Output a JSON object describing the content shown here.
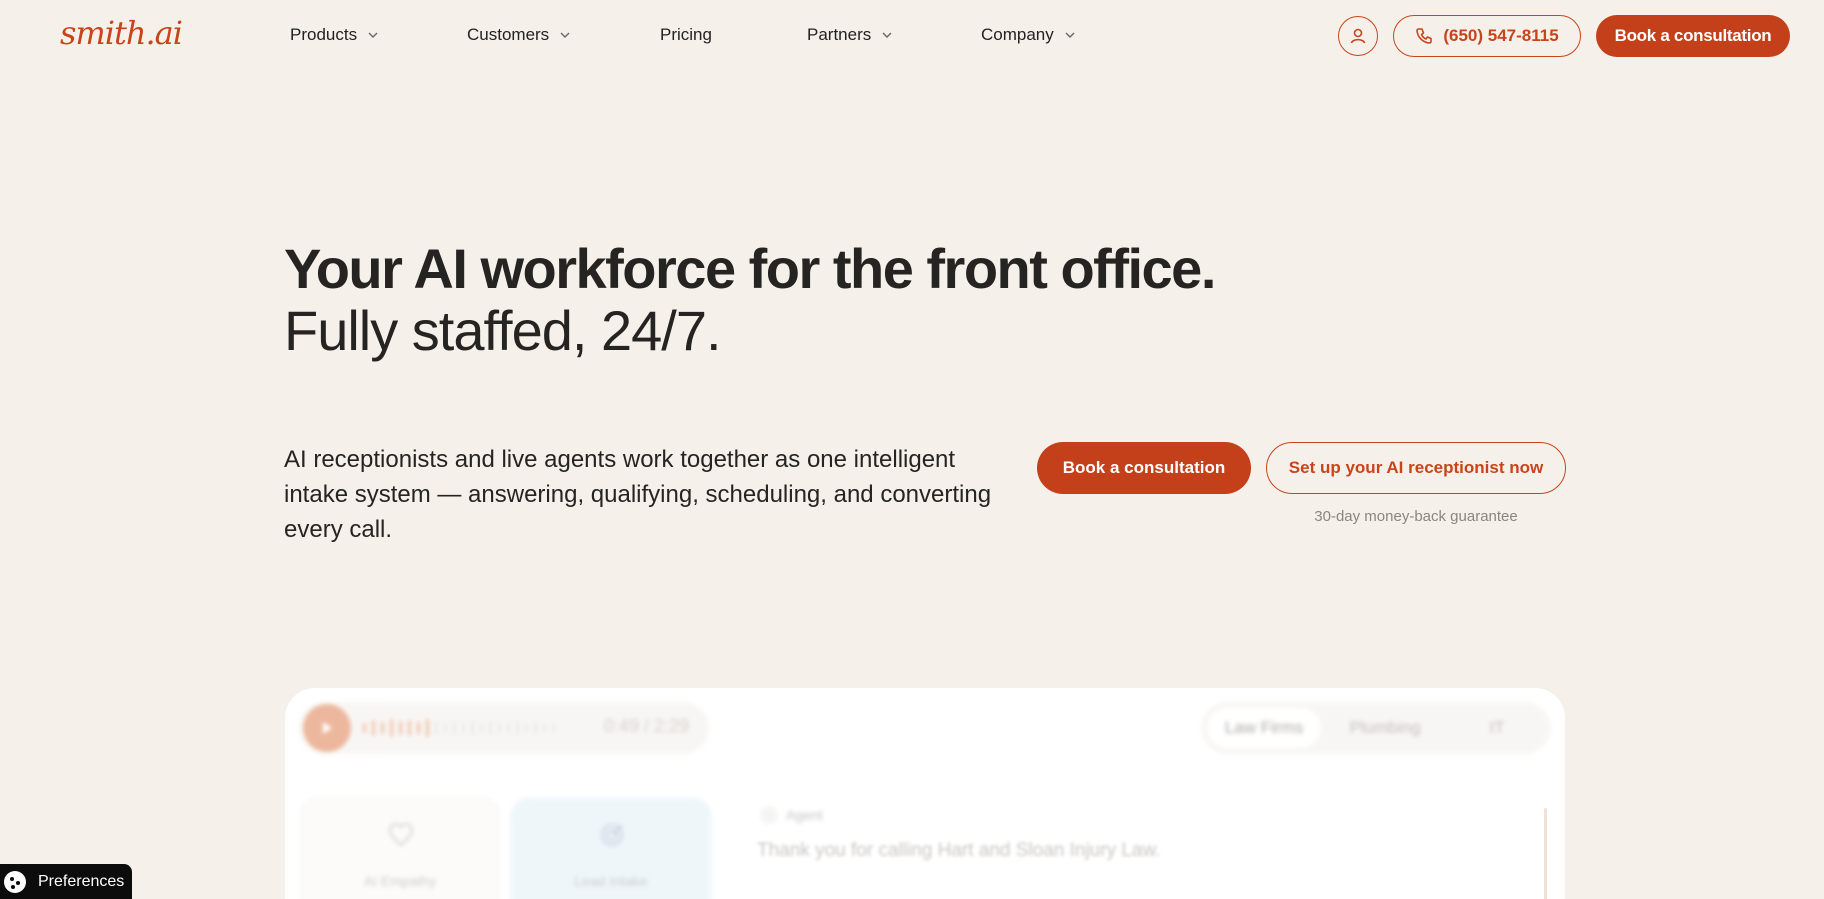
{
  "brand": {
    "logo": "smith.ai",
    "accent": "#c4401a",
    "background": "#f5f1ea"
  },
  "nav": {
    "items": [
      {
        "label": "Products",
        "has_dropdown": true
      },
      {
        "label": "Customers",
        "has_dropdown": true
      },
      {
        "label": "Pricing",
        "has_dropdown": false
      },
      {
        "label": "Partners",
        "has_dropdown": true
      },
      {
        "label": "Company",
        "has_dropdown": true
      }
    ],
    "account_icon": "user-icon",
    "phone": "(650) 547-8115",
    "phone_icon": "phone-icon",
    "cta": "Book a consultation"
  },
  "hero": {
    "title": "Your AI workforce for the front office.",
    "subtitle": "Fully staffed, 24/7.",
    "lead": "AI receptionists and live agents work together as one intelligent intake system — answering, qualifying, scheduling, and converting every call.",
    "primary_cta": "Book a consultation",
    "secondary_cta": "Set up your AI receptionist now",
    "guarantee": "30-day money-back guarantee"
  },
  "demo": {
    "player": {
      "time": "0:49 / 2:29",
      "play_icon": "play-icon"
    },
    "tabs": [
      {
        "label": "Law Firms",
        "active": true
      },
      {
        "label": "Plumbing",
        "active": false
      },
      {
        "label": "IT",
        "active": false
      }
    ],
    "features": [
      {
        "label": "AI Empathy",
        "icon": "heart-icon"
      },
      {
        "label": "Lead Intake",
        "icon": "target-icon"
      }
    ],
    "speaker": "Agent",
    "transcript": "Thank you for calling Hart and Sloan Injury Law."
  },
  "preferences": {
    "label": "Preferences",
    "icon": "cookie-icon"
  }
}
